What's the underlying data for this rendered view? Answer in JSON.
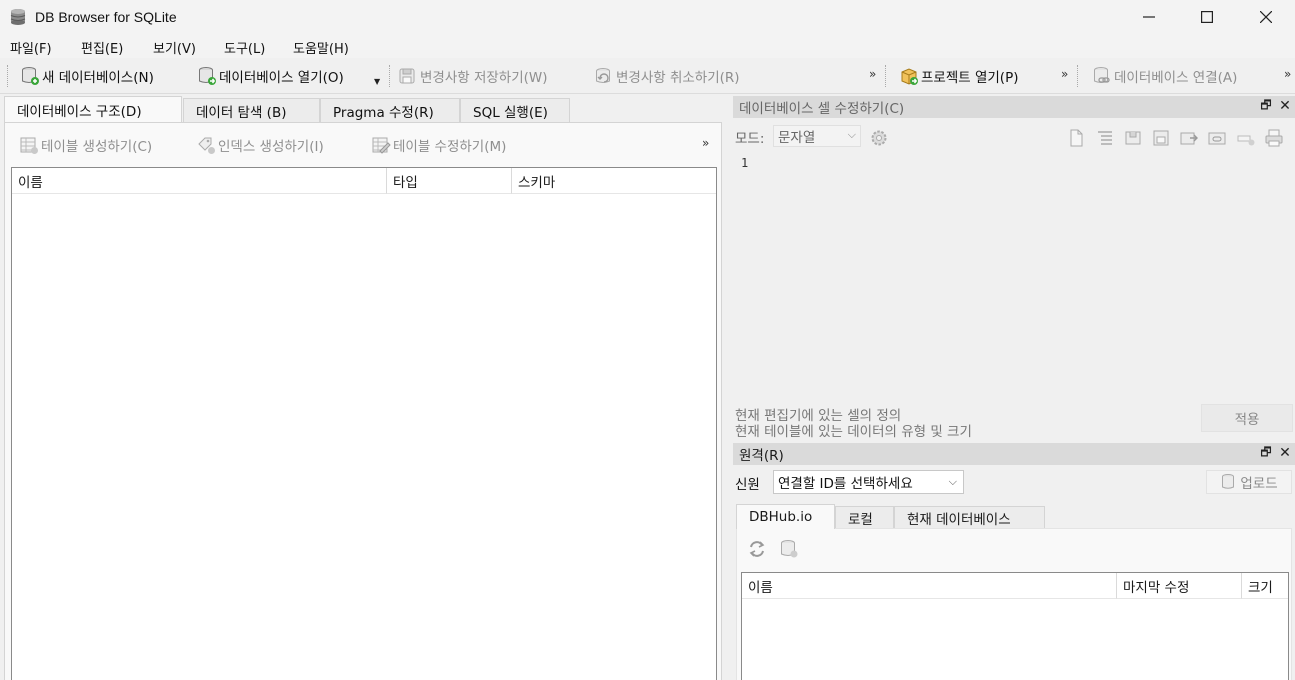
{
  "window": {
    "title": "DB Browser for SQLite",
    "icons": [
      "app-database-icon",
      "minimize-icon",
      "maximize-icon",
      "close-icon"
    ]
  },
  "menubar": {
    "items": [
      "파일(F)",
      "편집(E)",
      "보기(V)",
      "도구(L)",
      "도움말(H)"
    ]
  },
  "toolbar": {
    "new_db": "새 데이터베이스(N)",
    "open_db": "데이터베이스 열기(O)",
    "write_changes": "변경사항 저장하기(W)",
    "revert_changes": "변경사항 취소하기(R)",
    "more": "»",
    "open_project": "프로젝트 열기(P)",
    "attach_db": "데이터베이스 연결(A)"
  },
  "main_tabs": [
    "데이터베이스 구조(D)",
    "데이터 탐색 (B)",
    "Pragma 수정(R)",
    "SQL 실행(E)"
  ],
  "structure_toolbar": {
    "create_table": "테이블 생성하기(C)",
    "create_index": "인덱스 생성하기(I)",
    "modify_table": "테이블 수정하기(M)",
    "more": "»"
  },
  "structure_columns": [
    "이름",
    "타입",
    "스키마"
  ],
  "edit_cell": {
    "title": "데이터베이스 셀 수정하기(C)",
    "mode_label": "모드:",
    "mode_value": "문자열",
    "line_number": "1",
    "info_line1": "현재 편집기에 있는 셀의 정의",
    "info_line2": "현재 테이블에 있는 데이터의 유형 및 크기",
    "apply": "적용"
  },
  "remote": {
    "title": "원격(R)",
    "identity_label": "신원",
    "identity_placeholder": "연결할 ID를 선택하세요",
    "upload": "업로드",
    "tabs": [
      "DBHub.io",
      "로컬",
      "현재 데이터베이스"
    ],
    "columns": [
      "이름",
      "마지막 수정",
      "크기"
    ]
  }
}
